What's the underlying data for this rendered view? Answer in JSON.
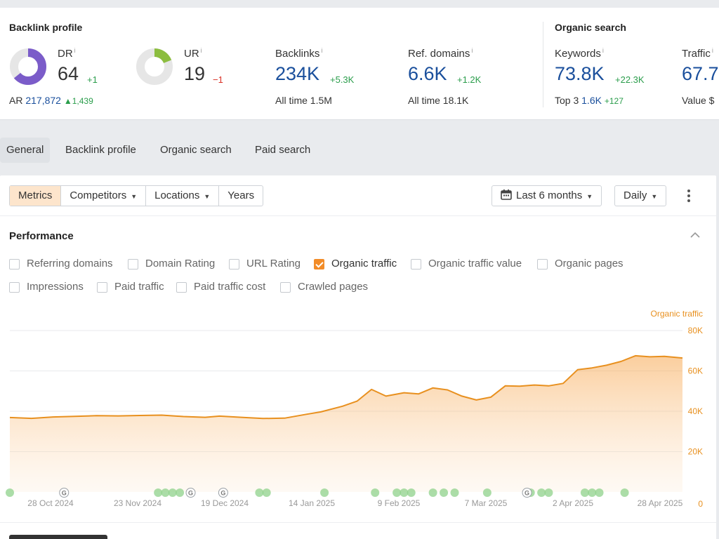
{
  "backlink_profile": {
    "title": "Backlink profile",
    "dr": {
      "label": "DR",
      "value": "64",
      "delta": "+1",
      "fill": 0.64,
      "color": "#7b5cc9"
    },
    "ar": {
      "label": "AR",
      "value": "217,872",
      "delta": "1,439"
    },
    "ur": {
      "label": "UR",
      "value": "19",
      "delta": "−1",
      "fill": 0.19,
      "color": "#8cbd3f"
    },
    "backlinks": {
      "label": "Backlinks",
      "value": "234K",
      "delta": "+5.3K",
      "sub_label": "All time",
      "sub_value": "1.5M"
    },
    "ref_domains": {
      "label": "Ref. domains",
      "value": "6.6K",
      "delta": "+1.2K",
      "sub_label": "All time",
      "sub_value": "18.1K"
    }
  },
  "organic_search": {
    "title": "Organic search",
    "keywords": {
      "label": "Keywords",
      "value": "73.8K",
      "delta": "+22.3K",
      "sub_label": "Top 3",
      "sub_value": "1.6K",
      "sub_delta": "+127"
    },
    "traffic": {
      "label": "Traffic",
      "value": "67.7",
      "sub_label": "Value",
      "sub_value": "$"
    }
  },
  "tabs": [
    "General",
    "Backlink profile",
    "Organic search",
    "Paid search"
  ],
  "active_tab": "General",
  "toolbar": {
    "segments": [
      "Metrics",
      "Competitors",
      "Locations",
      "Years"
    ],
    "date_range": "Last 6 months",
    "granularity": "Daily"
  },
  "performance": {
    "title": "Performance",
    "checkboxes": [
      {
        "label": "Referring domains",
        "checked": false
      },
      {
        "label": "Domain Rating",
        "checked": false
      },
      {
        "label": "URL Rating",
        "checked": false
      },
      {
        "label": "Organic traffic",
        "checked": true
      },
      {
        "label": "Organic traffic value",
        "checked": false
      },
      {
        "label": "Organic pages",
        "checked": false
      },
      {
        "label": "Impressions",
        "checked": false
      },
      {
        "label": "Paid traffic",
        "checked": false
      },
      {
        "label": "Paid traffic cost",
        "checked": false
      },
      {
        "label": "Crawled pages",
        "checked": false
      }
    ]
  },
  "colors": {
    "accent": "#f28c28",
    "blue": "#1a4f9c",
    "green": "#2a9d4b",
    "red": "#d93025"
  },
  "chart_data": {
    "type": "area",
    "title": "",
    "series_label": "Organic traffic",
    "yaxis_side": "right",
    "ylim": [
      0,
      80000
    ],
    "yticks": [
      0,
      20000,
      40000,
      60000,
      80000
    ],
    "ytick_labels": [
      "0",
      "20K",
      "40K",
      "60K",
      "80K"
    ],
    "xtick_labels": [
      "28 Oct 2024",
      "23 Nov 2024",
      "19 Dec 2024",
      "14 Jan 2025",
      "9 Feb 2025",
      "7 Mar 2025",
      "2 Apr 2025",
      "28 Apr 2025"
    ],
    "x_start": "2024-10-28",
    "x_end": "2025-05-02",
    "grid": true,
    "series": [
      {
        "name": "Organic traffic",
        "points": [
          [
            "2024-10-28",
            36900
          ],
          [
            "2024-11-03",
            36500
          ],
          [
            "2024-11-09",
            37200
          ],
          [
            "2024-11-15",
            37500
          ],
          [
            "2024-11-21",
            37800
          ],
          [
            "2024-11-27",
            37700
          ],
          [
            "2024-12-03",
            37900
          ],
          [
            "2024-12-09",
            38100
          ],
          [
            "2024-12-15",
            37400
          ],
          [
            "2024-12-21",
            37000
          ],
          [
            "2024-12-25",
            37600
          ],
          [
            "2024-12-31",
            37000
          ],
          [
            "2025-01-06",
            36400
          ],
          [
            "2025-01-12",
            36600
          ],
          [
            "2025-01-18",
            38500
          ],
          [
            "2025-01-22",
            39700
          ],
          [
            "2025-01-28",
            42500
          ],
          [
            "2025-02-01",
            45000
          ],
          [
            "2025-02-05",
            50800
          ],
          [
            "2025-02-09",
            47500
          ],
          [
            "2025-02-14",
            49200
          ],
          [
            "2025-02-18",
            48600
          ],
          [
            "2025-02-22",
            51600
          ],
          [
            "2025-02-26",
            50600
          ],
          [
            "2025-03-02",
            47500
          ],
          [
            "2025-03-06",
            45600
          ],
          [
            "2025-03-10",
            47000
          ],
          [
            "2025-03-14",
            52600
          ],
          [
            "2025-03-18",
            52400
          ],
          [
            "2025-03-22",
            53000
          ],
          [
            "2025-03-26",
            52600
          ],
          [
            "2025-03-30",
            53800
          ],
          [
            "2025-04-03",
            60600
          ],
          [
            "2025-04-07",
            61500
          ],
          [
            "2025-04-11",
            62800
          ],
          [
            "2025-04-15",
            64700
          ],
          [
            "2025-04-19",
            67500
          ],
          [
            "2025-04-23",
            67000
          ],
          [
            "2025-04-27",
            67200
          ],
          [
            "2025-05-02",
            66400
          ]
        ]
      }
    ],
    "annotations": {
      "dot_color": "#8fd18b",
      "update_markers": [
        "2024-10-28",
        "2024-12-08",
        "2024-12-10",
        "2024-12-12",
        "2024-12-14",
        "2025-01-05",
        "2025-01-07",
        "2025-01-23",
        "2025-02-06",
        "2025-02-12",
        "2025-02-14",
        "2025-02-16",
        "2025-02-22",
        "2025-02-25",
        "2025-02-28",
        "2025-03-09",
        "2025-03-21",
        "2025-03-24",
        "2025-03-26",
        "2025-04-05",
        "2025-04-07",
        "2025-04-09",
        "2025-04-16"
      ],
      "google_markers": [
        "2024-11-12",
        "2024-12-17",
        "2024-12-26",
        "2025-03-20"
      ]
    }
  }
}
